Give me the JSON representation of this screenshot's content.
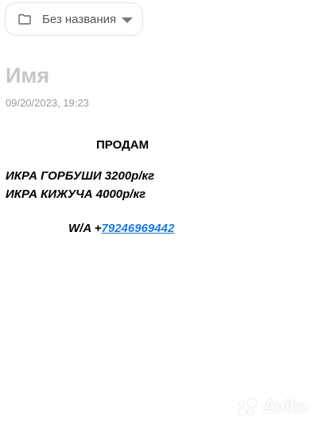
{
  "folder": {
    "label": "Без названия",
    "icon": "folder-icon"
  },
  "note": {
    "title": "Имя",
    "datetime": "09/20/2023, 19:23",
    "heading": "ПРОДАМ",
    "items": [
      "ИКРА ГОРБУШИ 3200р/кг",
      "ИКРА КИЖУЧА 4000р/кг"
    ],
    "contact_prefix": "W/A +",
    "contact_phone": "79246969442"
  },
  "watermark": {
    "text": "Avito"
  },
  "colors": {
    "link": "#1e7ad6",
    "title_placeholder": "#c6c6c6",
    "date": "#9a9a9a"
  }
}
